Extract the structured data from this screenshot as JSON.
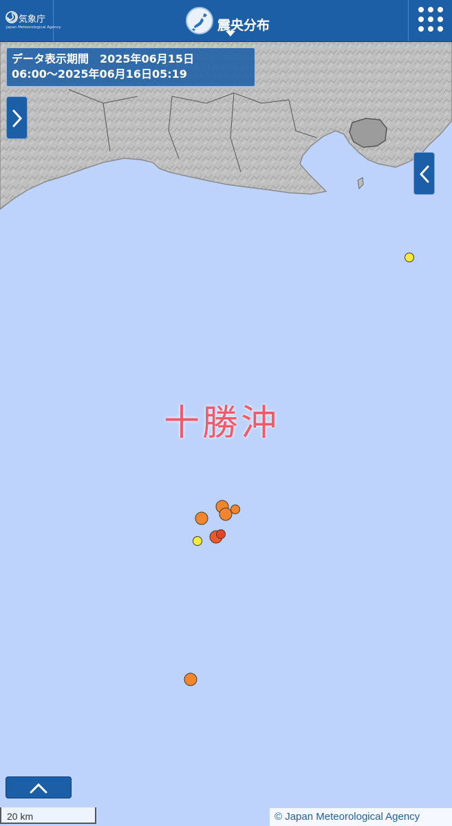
{
  "header": {
    "agency_name": "気象庁",
    "agency_name_en": "Japan Meteorological Agency",
    "title": "震央分布",
    "colors": {
      "bar": "#1d5fa6",
      "text": "#ffffff"
    }
  },
  "period": {
    "line1": "データ表示期間　2025年06月15日",
    "line2": "06:00～2025年06月16日05:19"
  },
  "map": {
    "region_label": "十勝沖",
    "sea_color": "#bdd3fb",
    "land_color": "#bdbdbd",
    "epicenters": [
      {
        "magnitude_class": "small",
        "color": "#f4ec3a"
      },
      {
        "magnitude_class": "medium",
        "color": "#f2862e"
      },
      {
        "magnitude_class": "medium",
        "color": "#f2862e"
      },
      {
        "magnitude_class": "small",
        "color": "#f2862e"
      },
      {
        "magnitude_class": "medium",
        "color": "#f2862e"
      },
      {
        "magnitude_class": "small",
        "color": "#f4ec3a"
      },
      {
        "magnitude_class": "medium",
        "color": "#ea5a2a"
      },
      {
        "magnitude_class": "small",
        "color": "#e8432a"
      },
      {
        "magnitude_class": "medium",
        "color": "#f2862e"
      }
    ]
  },
  "controls": {
    "left_panel_icon": "chevron-right-icon",
    "right_panel_icon": "chevron-left-icon",
    "scroll_up_icon": "chevron-up-icon",
    "menu_icon": "grid-menu-icon"
  },
  "scale": {
    "label": "20 km"
  },
  "attribution": "© Japan Meteorological Agency"
}
